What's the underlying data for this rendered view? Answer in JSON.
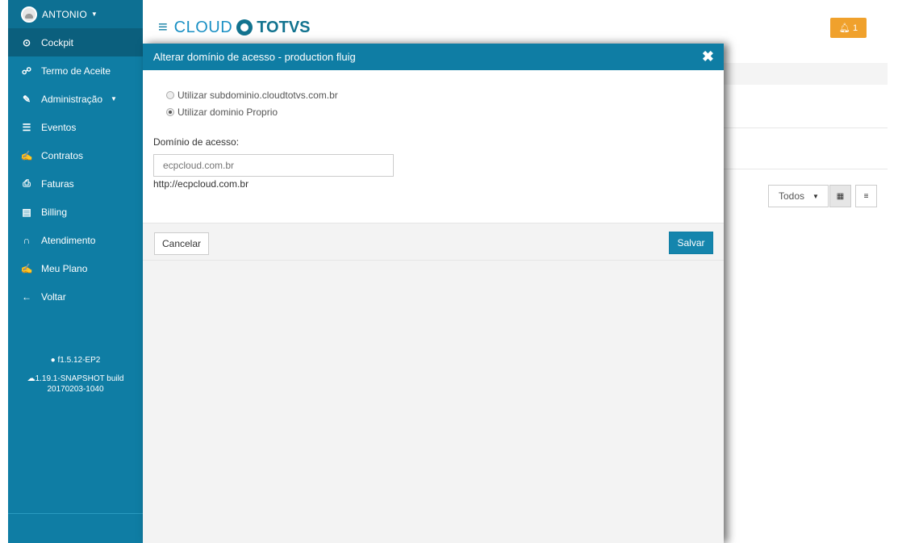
{
  "user": {
    "name": "ANTONIO"
  },
  "nav": {
    "items": [
      {
        "label": "Cockpit",
        "icon": "dashboard-icon"
      },
      {
        "label": "Termo de Aceite",
        "icon": "handshake-icon"
      },
      {
        "label": "Administração",
        "icon": "wrench-icon"
      },
      {
        "label": "Eventos",
        "icon": "list-icon"
      },
      {
        "label": "Contratos",
        "icon": "edit-icon"
      },
      {
        "label": "Faturas",
        "icon": "print-icon"
      },
      {
        "label": "Billing",
        "icon": "file-icon"
      },
      {
        "label": "Atendimento",
        "icon": "headphones-icon"
      },
      {
        "label": "Meu Plano",
        "icon": "edit-icon"
      },
      {
        "label": "Voltar",
        "icon": "arrow-left-icon"
      }
    ]
  },
  "footer": {
    "version": "f1.5.12-EP2",
    "build_line1": "1.19.1-SNAPSHOT build",
    "build_line2": "20170203-1040"
  },
  "header": {
    "logo_cloud": "CLOUD",
    "logo_brand": "TOTVS",
    "notifications_count": "1"
  },
  "background": {
    "filter_value": "Todos"
  },
  "modal": {
    "title": "Alterar domínio de acesso - production fluig",
    "options": [
      {
        "label": "Utilizar subdominio.cloudtotvs.com.br",
        "checked": false
      },
      {
        "label": "Utilizar dominio Proprio",
        "checked": true
      }
    ],
    "field_label": "Domínio de acesso:",
    "field_placeholder": "ecpcloud.com.br",
    "field_help": "http://ecpcloud.com.br",
    "cancel_label": "Cancelar",
    "save_label": "Salvar"
  },
  "colors": {
    "sidebar": "#0f7da4",
    "header_bar": "#0f7da4",
    "notification": "#f0a12c",
    "primary_button": "#1585ad"
  }
}
